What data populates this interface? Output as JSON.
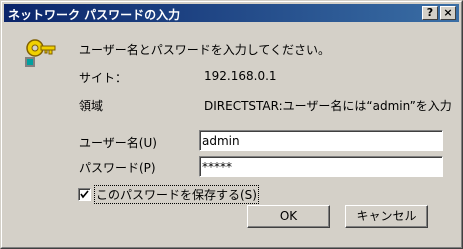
{
  "window": {
    "title": "ネットワーク パスワードの入力"
  },
  "titlebar": {
    "help_label": "?",
    "close_label": "×"
  },
  "dialog": {
    "prompt": "ユーザー名とパスワードを入力してください。",
    "site_label": "サイト：",
    "site_value": "192.168.0.1",
    "realm_label": "領域",
    "realm_value": "DIRECTSTAR:ユーザー名には“admin”を入力",
    "username_label": "ユーザー名(U)",
    "username_value": "admin",
    "password_label": "パスワード(P)",
    "password_value": "*****",
    "save_password_label": "このパスワードを保存する(S)",
    "save_password_checked": true,
    "ok_label": "OK",
    "cancel_label": "キャンセル"
  },
  "icons": {
    "key": "key-icon",
    "check": "check-icon"
  },
  "colors": {
    "titlebar": "#0a246a",
    "face": "#d4d0c8"
  }
}
